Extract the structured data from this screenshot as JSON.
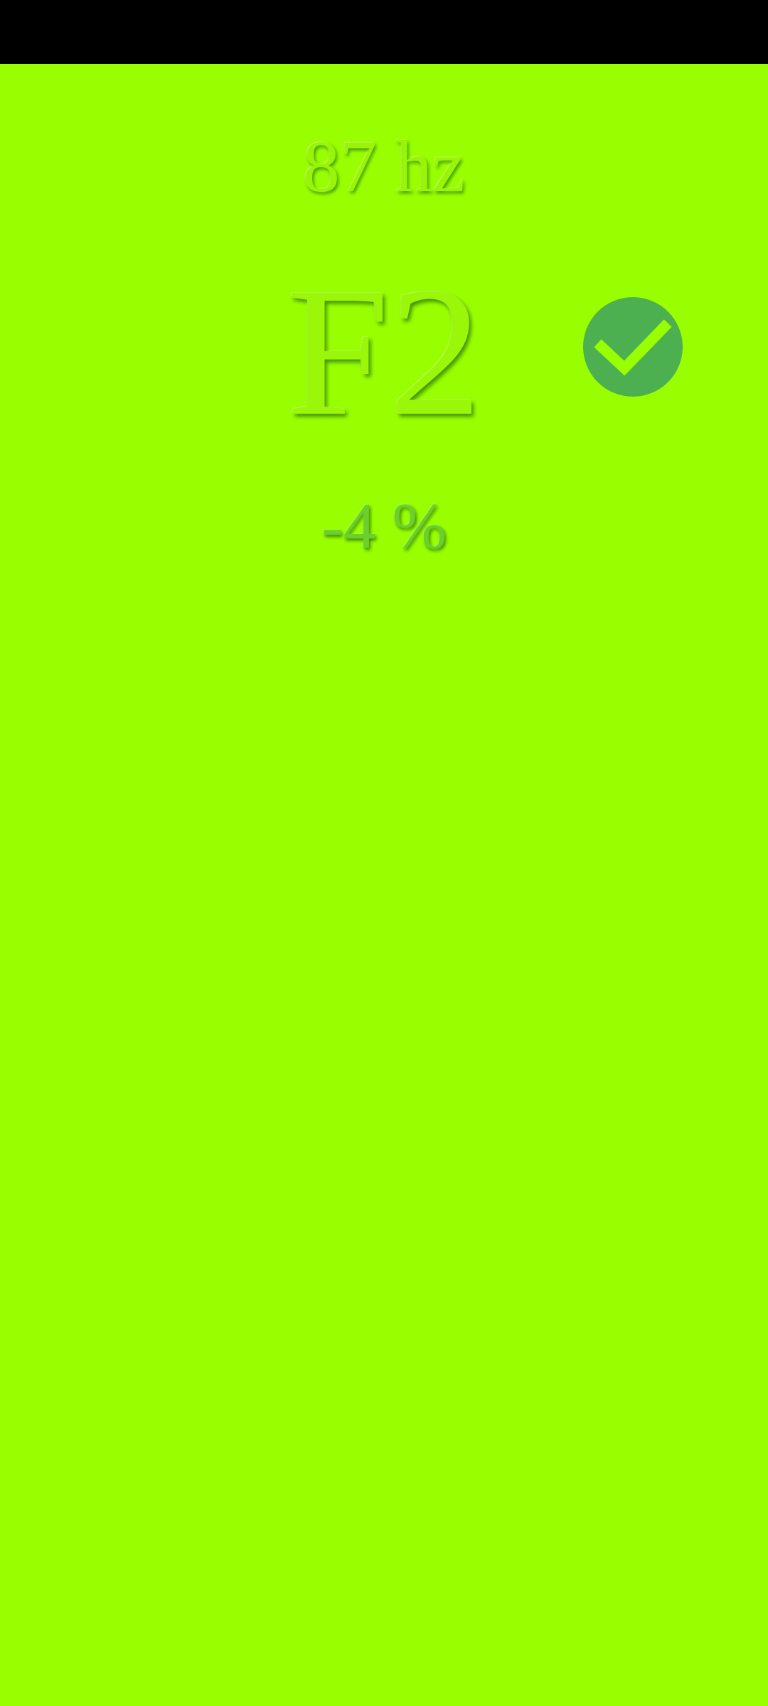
{
  "tuner": {
    "frequency": "87 hz",
    "note": "F2",
    "deviation": "-4 %",
    "status_icon": "check-circle-icon",
    "in_tune": true
  },
  "colors": {
    "background": "#99ff00",
    "status_bar": "#000000",
    "badge": "#4caf50",
    "check_mark": "#99ff00"
  }
}
